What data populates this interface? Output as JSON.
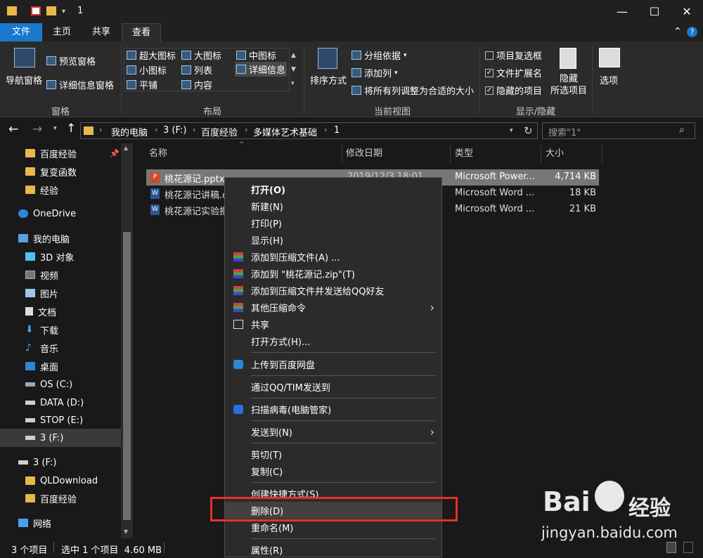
{
  "window": {
    "title": "1",
    "minimize": "—",
    "maximize": "☐",
    "close": "✕"
  },
  "tabs": [
    "文件",
    "主页",
    "共享",
    "查看"
  ],
  "ribbon": {
    "panes": {
      "nav_pane": "导航窗格",
      "preview_pane": "预览窗格",
      "details_pane": "详细信息窗格",
      "label": "窗格"
    },
    "layout": {
      "extra_large": "超大图标",
      "large": "大图标",
      "medium": "中图标",
      "small": "小图标",
      "list": "列表",
      "details": "详细信息",
      "tiles": "平铺",
      "content": "内容",
      "label": "布局"
    },
    "current_view": {
      "sort": "排序方式",
      "group_by": "分组依据",
      "add_column": "添加列",
      "fit_columns": "将所有列调整为合适的大小",
      "label": "当前视图"
    },
    "show_hide": {
      "item_checkboxes": "项目复选框",
      "file_extensions": "文件扩展名",
      "hidden_items": "隐藏的项目",
      "hide_selected_line1": "隐藏",
      "hide_selected_line2": "所选项目",
      "options": "选项",
      "label": "显示/隐藏"
    }
  },
  "address": {
    "breadcrumbs": [
      "我的电脑",
      "3 (F:)",
      "百度经验",
      "多媒体艺术基础",
      "1"
    ],
    "search_placeholder": "搜索\"1\""
  },
  "nav": {
    "items": [
      {
        "label": "百度经验",
        "icon": "folder-icon"
      },
      {
        "label": "复变函数",
        "icon": "folder-icon"
      },
      {
        "label": "经验",
        "icon": "folder-icon"
      },
      {
        "label": "OneDrive",
        "icon": "cloud-icon"
      },
      {
        "label": "我的电脑",
        "icon": "computer-icon"
      },
      {
        "label": "3D 对象",
        "icon": "cube-icon"
      },
      {
        "label": "视频",
        "icon": "video-icon"
      },
      {
        "label": "图片",
        "icon": "picture-icon"
      },
      {
        "label": "文档",
        "icon": "document-icon"
      },
      {
        "label": "下载",
        "icon": "download-icon"
      },
      {
        "label": "音乐",
        "icon": "music-icon"
      },
      {
        "label": "桌面",
        "icon": "desktop-icon"
      },
      {
        "label": "OS (C:)",
        "icon": "drive-icon"
      },
      {
        "label": "DATA (D:)",
        "icon": "drive-icon"
      },
      {
        "label": "STOP (E:)",
        "icon": "drive-icon"
      },
      {
        "label": "3 (F:)",
        "icon": "drive-icon"
      },
      {
        "label": "3 (F:)",
        "icon": "drive-icon"
      },
      {
        "label": "QLDownload",
        "icon": "folder-icon"
      },
      {
        "label": "百度经验",
        "icon": "folder-icon"
      },
      {
        "label": "网络",
        "icon": "network-icon"
      }
    ]
  },
  "files": {
    "columns": [
      "名称",
      "修改日期",
      "类型",
      "大小"
    ],
    "rows": [
      {
        "name": "桃花源记.pptx",
        "date": "2019/12/3 18:01",
        "type": "Microsoft Power...",
        "size": "4,714 KB"
      },
      {
        "name": "桃花源记讲稿.d",
        "date": "",
        "type": "Microsoft Word ...",
        "size": "18 KB"
      },
      {
        "name": "桃花源记实验报",
        "date": "",
        "type": "Microsoft Word ...",
        "size": "21 KB"
      }
    ]
  },
  "status": {
    "count": "3 个项目",
    "selected": "选中 1 个项目  4.60 MB"
  },
  "context_menu": {
    "items": [
      "打开(O)",
      "新建(N)",
      "打印(P)",
      "显示(H)",
      "添加到压缩文件(A) ...",
      "添加到 \"桃花源记.zip\"(T)",
      "添加到压缩文件并发送给QQ好友",
      "其他压缩命令",
      "共享",
      "打开方式(H)...",
      "上传到百度网盘",
      "通过QQ/TIM发送到",
      "扫描病毒(电脑管家)",
      "发送到(N)",
      "剪切(T)",
      "复制(C)",
      "创建快捷方式(S)",
      "删除(D)",
      "重命名(M)",
      "属性(R)"
    ]
  },
  "watermark": {
    "brand": "Bai",
    "brand2": "经验",
    "url": "jingyan.baidu.com"
  },
  "colors": {
    "accent": "#1979ca",
    "highlight_box": "#e8312a",
    "background": "#191919"
  }
}
